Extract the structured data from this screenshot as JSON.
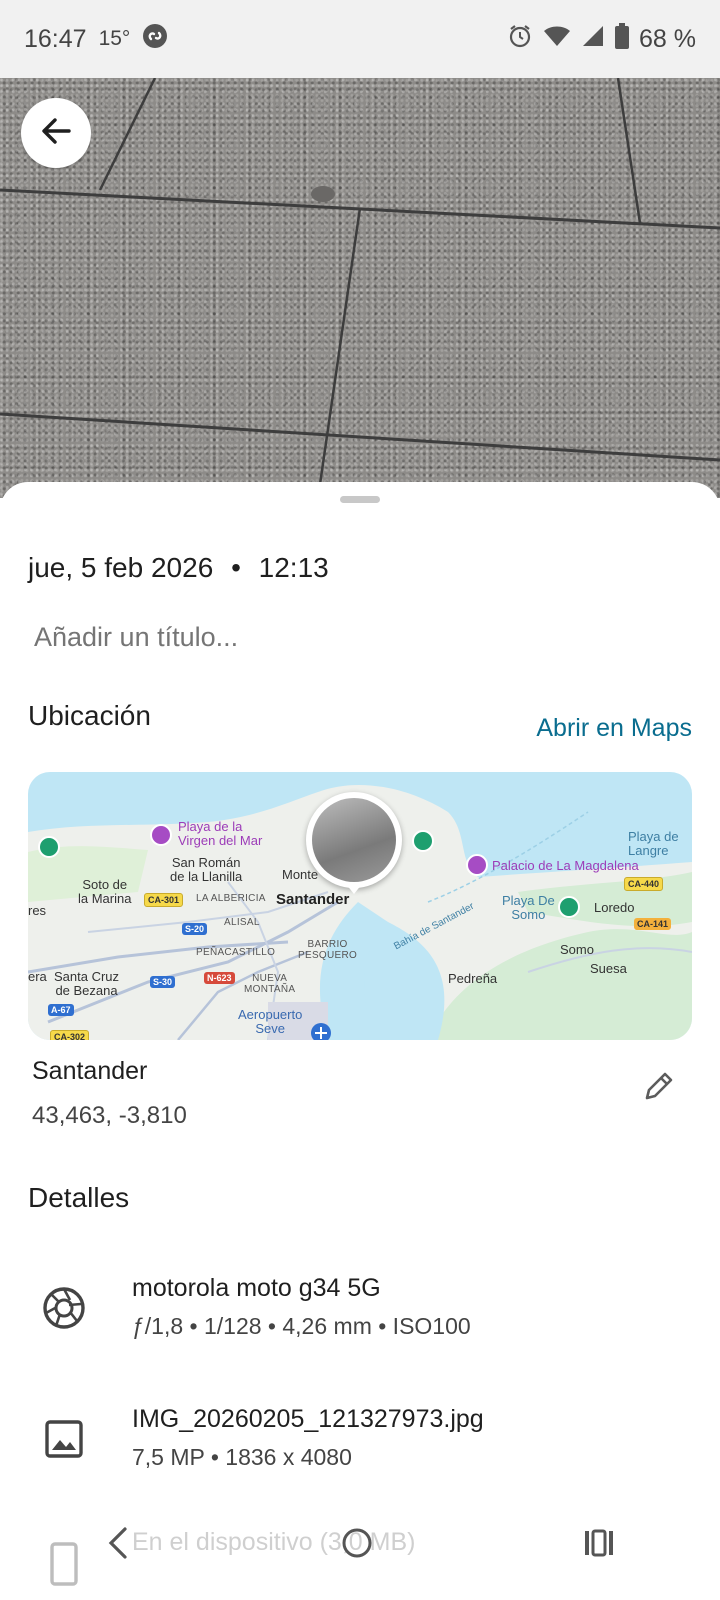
{
  "status_bar": {
    "time": "16:47",
    "temperature": "15°",
    "battery": "68 %"
  },
  "info": {
    "date": "jue, 5 feb 2026",
    "separator": "•",
    "time": "12:13",
    "title_placeholder": "Añadir un título..."
  },
  "location": {
    "heading": "Ubicación",
    "open_maps": "Abrir en Maps",
    "place_name": "Santander",
    "coordinates": "43,463, -3,810",
    "map_labels": {
      "playa_virgen": "Playa de la\nVirgen del Mar",
      "san_roman": "San Román\nde la Llanilla",
      "soto_marina": "Soto de\nla Marina",
      "monte": "Monte",
      "santander": "Santander",
      "la_albericia": "LA ALBERICIA",
      "alisal": "ALISAL",
      "penacastillo": "PEÑACASTILLO",
      "barrio_pesquero": "BARRIO\nPESQUERO",
      "nueva_montana": "NUEVA\nMONTAÑA",
      "santa_cruz": "Santa Cruz\nde Bezana",
      "aeropuerto": "Aeropuerto\nSeve",
      "palacio": "Palacio de La Magdalena",
      "playa_langre": "Playa de\nLangre",
      "playa_somo": "Playa De\nSomo",
      "loredo": "Loredo",
      "somo": "Somo",
      "suesa": "Suesa",
      "pedrena": "Pedreña",
      "bahia": "Bahía de Santander",
      "res": "res",
      "era": "era",
      "ca301": "CA-301",
      "s20": "S-20",
      "s30": "S-30",
      "n623": "N-623",
      "a67": "A-67",
      "ca302": "CA-302",
      "ca440": "CA-440",
      "ca141": "CA-141"
    }
  },
  "details": {
    "heading": "Detalles",
    "camera": {
      "name": "motorola moto g34 5G",
      "specs": "ƒ/1,8  •  1/128  •  4,26 mm  •  ISO100"
    },
    "file": {
      "name": "IMG_20260205_121327973.jpg",
      "specs": "7,5 MP  •  1836 x 4080"
    },
    "storage": {
      "label": "En el dispositivo (3,0 MB)"
    }
  },
  "icons": {
    "back": "arrow-left-icon",
    "edit": "pencil-icon",
    "camera": "aperture-icon",
    "image": "image-icon",
    "device": "phone-icon"
  }
}
